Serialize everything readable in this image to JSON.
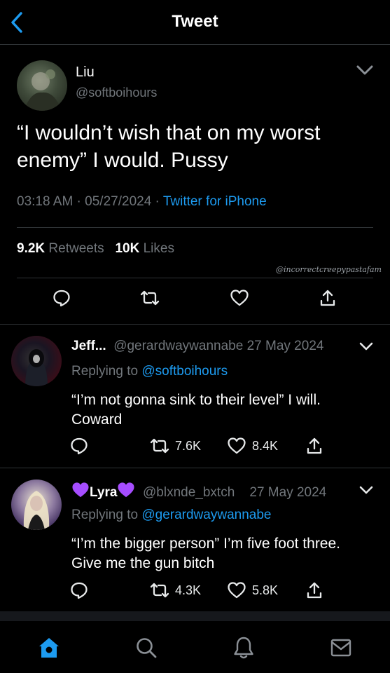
{
  "header": {
    "title": "Tweet"
  },
  "main_tweet": {
    "name": "Liu",
    "handle": "@softboihours",
    "text": "“I wouldn’t wish that on my worst enemy” I would. Pussy",
    "time": "03:18 AM",
    "date": "05/27/2024",
    "source": "Twitter for iPhone",
    "retweets_count": "9.2K",
    "retweets_label": "Retweets",
    "likes_count": "10K",
    "likes_label": "Likes",
    "watermark": "@incorrectcreepypastafam"
  },
  "replies": [
    {
      "name": "Jeff...",
      "handle": "@gerardwaywannabe",
      "date": "27 May 2024",
      "replying_label": "Replying to",
      "replying_handle": "@softboihours",
      "text": "“I’m not gonna sink to their level” I will. Coward",
      "retweets": "7.6K",
      "likes": "8.4K"
    },
    {
      "name": "Lyra",
      "handle": "@blxnde_bxtch",
      "date": "27 May 2024",
      "replying_label": "Replying to",
      "replying_handle": "@gerardwaywannabe",
      "text": "“I’m the bigger person” I’m five foot three. Give me the gun bitch",
      "retweets": "4.3K",
      "likes": "5.8K"
    }
  ],
  "colors": {
    "background": "#000000",
    "accent": "#1d9bf0",
    "muted": "#71767b",
    "divider": "#2f3336",
    "emoji_heart": "#a64dff"
  },
  "icons": [
    "back-icon",
    "chevron-down-icon",
    "reply-icon",
    "retweet-icon",
    "like-icon",
    "share-icon",
    "home-icon",
    "search-icon",
    "notifications-icon",
    "messages-icon",
    "purple-heart-icon"
  ]
}
